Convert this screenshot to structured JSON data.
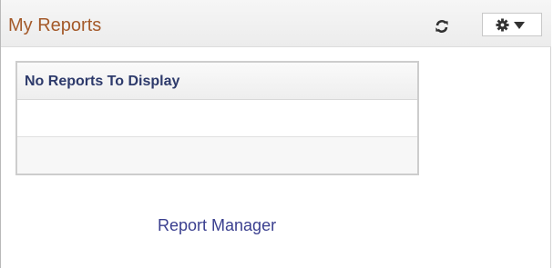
{
  "pagelet": {
    "title": "My Reports",
    "refresh_icon": "refresh-icon",
    "options_icon": "gear-icon",
    "options_caret": "chevron-down-icon"
  },
  "grid": {
    "header": "No Reports To Display",
    "rows": [
      "",
      ""
    ]
  },
  "footer": {
    "link_label": "Report Manager"
  },
  "colors": {
    "title": "#a45a2a",
    "grid_header_text": "#2d3a6b",
    "link": "#3a3f8f"
  }
}
